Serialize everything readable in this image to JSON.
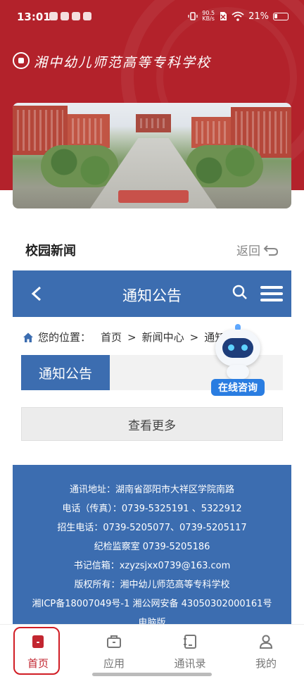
{
  "status_bar": {
    "time": "13:01",
    "net_speed_value": "90.5",
    "net_speed_unit": "KB/s",
    "battery": "21%"
  },
  "header": {
    "school_name": "湘中幼儿师范高等专科学校",
    "accent_color": "#b3222b"
  },
  "news": {
    "title": "校园新闻",
    "back_label": "返回"
  },
  "site": {
    "title": "通知公告",
    "breadcrumb": {
      "prefix": "您的位置：",
      "items": [
        "首页",
        "新闻中心",
        "通知公告"
      ]
    },
    "section_title": "通知公告",
    "more_label": "查看更多",
    "footer_lines": [
      "通讯地址：湖南省邵阳市大祥区学院南路",
      "电话（传真）：0739-5325191 、5322912",
      "招生电话：0739-5205077、0739-5205117",
      "纪检监察室  0739-5205186",
      "书记信箱：xzyzsjxx0739@163.com",
      "版权所有：湘中幼儿师范高等专科学校",
      "湘ICP备18007049号-1 湘公网安备 43050302000161号",
      "电脑版"
    ],
    "brand_color": "#3c6db0"
  },
  "chatbot": {
    "label": "在线咨询"
  },
  "tabbar": {
    "items": [
      {
        "label": "首页",
        "icon": "home-icon"
      },
      {
        "label": "应用",
        "icon": "briefcase-icon"
      },
      {
        "label": "通讯录",
        "icon": "contacts-icon"
      },
      {
        "label": "我的",
        "icon": "user-icon"
      }
    ],
    "active_color": "#c22630"
  }
}
